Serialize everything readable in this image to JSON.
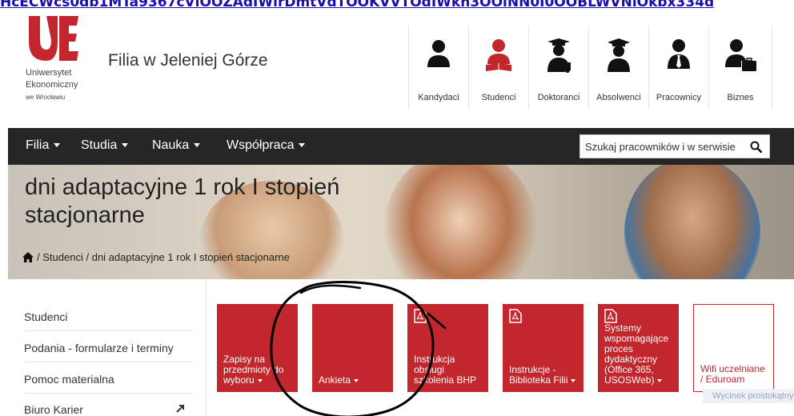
{
  "url_strip": {
    "text": "HcECWcs0db1MTa9367cVlOOZAdIWirDmtVdTOOKVVTOdIWkh3OOlNN0I0OOBLWVNlOkbx334d"
  },
  "logo": {
    "line1": "Uniwersytet",
    "line2": "Ekonomiczny",
    "line3": "we Wrocławiu",
    "brand_color": "#c1272d"
  },
  "site_title": "Filia w Jeleniej Górze",
  "roles": [
    {
      "label": "Kandydaci",
      "icon": "person-icon"
    },
    {
      "label": "Studenci",
      "icon": "student-book-icon"
    },
    {
      "label": "Doktoranci",
      "icon": "graduate-certificate-icon"
    },
    {
      "label": "Absolwenci",
      "icon": "graduate-icon"
    },
    {
      "label": "Pracownicy",
      "icon": "employee-tie-icon"
    },
    {
      "label": "Biznes",
      "icon": "business-briefcase-icon"
    }
  ],
  "nav": [
    {
      "label": "Filia"
    },
    {
      "label": "Studia"
    },
    {
      "label": "Nauka"
    },
    {
      "label": "Współpraca"
    }
  ],
  "search": {
    "placeholder": "Szukaj pracowników i w serwisie",
    "icon": "search-icon"
  },
  "page": {
    "title": "dni adaptacyjne 1 rok I stopień stacjonarne",
    "breadcrumb": {
      "sep": "/",
      "items": [
        "Studenci",
        "dni adaptacyjne 1 rok I stopień stacjonarne"
      ]
    }
  },
  "sidebar": [
    {
      "label": "Studenci"
    },
    {
      "label": "Podania - formularze i terminy"
    },
    {
      "label": "Pomoc materialna"
    },
    {
      "label": "Biuro Karier"
    }
  ],
  "tiles": [
    {
      "label": "Zapisy na przedmioty do wyboru"
    },
    {
      "label": "Ankieta"
    },
    {
      "label": "Instrukcja obsługi szkolenia BHP"
    },
    {
      "label": "Instrukcje - Biblioteka Filii"
    },
    {
      "label": "Systemy wspomagające proces dydaktyczny (Office 365, USOSWeb)"
    },
    {
      "label": "Wifi uczelniane / Eduroam"
    }
  ],
  "tooltip": "Wycinek prostokątny",
  "colors": {
    "navbar": "#262626",
    "accent": "#c1272d",
    "text": "#333333"
  }
}
